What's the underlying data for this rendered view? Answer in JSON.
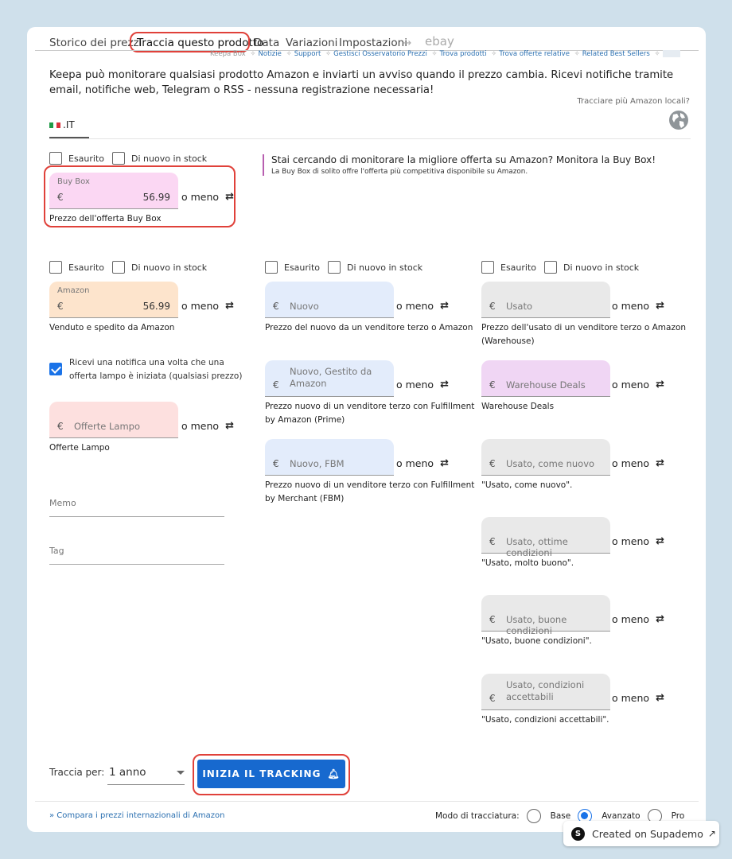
{
  "tabs": [
    {
      "label": "Storico dei prezzi"
    },
    {
      "label": "Traccia questo prodotto"
    },
    {
      "label": "Data"
    },
    {
      "label": "Variazioni"
    },
    {
      "label": "Impostazioni"
    },
    {
      "label": "→"
    },
    {
      "label": "ebay"
    }
  ],
  "sublinks": {
    "prefix": "Keepa Box",
    "sep": "✧",
    "items": [
      "Notizie",
      "Support",
      "Gestisci Osservatorio Prezzi",
      "Trova prodotti",
      "Trova offerte relative",
      "Related Best Sellers"
    ]
  },
  "intro": "Keepa può monitorare qualsiasi prodotto Amazon e inviarti un avviso quando il prezzo cambia. Ricevi notifiche tramite email, notifiche web, Telegram o RSS - nessuna registrazione necessaria!",
  "locale": {
    "question": "Tracciare più Amazon locali?",
    "tab": ".IT",
    "flag_colors": [
      "#1f9a46",
      "#ffffff",
      "#d9303a"
    ]
  },
  "checkbox": {
    "out": "Esaurito",
    "back": "Di nuovo in stock"
  },
  "or_less": "o meno",
  "repeat_icon": "⇄",
  "currency": "€",
  "buybox": {
    "label": "Buy Box",
    "value": "56.99",
    "caption": "Prezzo dell'offerta Buy Box"
  },
  "buybox_note": {
    "title": "Stai cercando di monitorare la migliore offerta su Amazon? Monitora la Buy Box!",
    "sub": "La Buy Box di solito offre l'offerta più competitiva disponibile su Amazon."
  },
  "amazon": {
    "label": "Amazon",
    "value": "56.99",
    "caption": "Venduto e spedito da Amazon"
  },
  "flash": {
    "checkbox": "Ricevi una notifica una volta che una offerta lampo è iniziata (qualsiasi prezzo)",
    "placeholder": "Offerte Lampo",
    "caption": "Offerte Lampo"
  },
  "memo": "Memo",
  "tag": "Tag",
  "col2": [
    {
      "placeholder": "Nuovo",
      "caption": "Prezzo del nuovo da un venditore terzo o Amazon"
    },
    {
      "placeholder": "Nuovo, Gestito da Amazon",
      "caption": "Prezzo nuovo di un venditore terzo con Fulfillment by Amazon (Prime)"
    },
    {
      "placeholder": "Nuovo, FBM",
      "caption": "Prezzo nuovo di un venditore terzo con Fulfillment by Merchant (FBM)"
    }
  ],
  "col3": [
    {
      "placeholder": "Usato",
      "caption": "Prezzo dell'usato di un venditore terzo o Amazon (Warehouse)"
    },
    {
      "placeholder": "Warehouse Deals",
      "caption": "Warehouse Deals"
    },
    {
      "placeholder": "Usato, come nuovo",
      "caption": "\"Usato, come nuovo\"."
    },
    {
      "placeholder": "Usato, ottime condizioni",
      "caption": "\"Usato, molto buono\"."
    },
    {
      "placeholder": "Usato, buone condizioni",
      "caption": "\"Usato, buone condizioni\"."
    },
    {
      "placeholder": "Usato, condizioni accettabili",
      "caption": "\"Usato, condizioni accettabili\"."
    }
  ],
  "track": {
    "label": "Traccia per:",
    "duration": "1 anno",
    "button": "INIZIA IL TRACKING",
    "bell_icon": "🔔︎"
  },
  "footer": {
    "compare": "» Compara i prezzi internazionali di Amazon",
    "mode_label": "Modo di tracciatura:",
    "modes": [
      "Base",
      "Avanzato",
      "Pro"
    ],
    "selected_mode": "Avanzato"
  },
  "badge": {
    "logo": "S",
    "text": "Created on Supademo",
    "arrow": "↗"
  },
  "colors": {
    "buybox_bg": "#fbd7f3",
    "amazon_bg": "#fde4cc",
    "flash_bg": "#fde0df",
    "new_bg": "#e3ecfb",
    "used_bg": "#e9e9e9",
    "warehouse_bg": "#f0d6f4",
    "accent": "#1769cf",
    "highlight": "#e0413a"
  }
}
